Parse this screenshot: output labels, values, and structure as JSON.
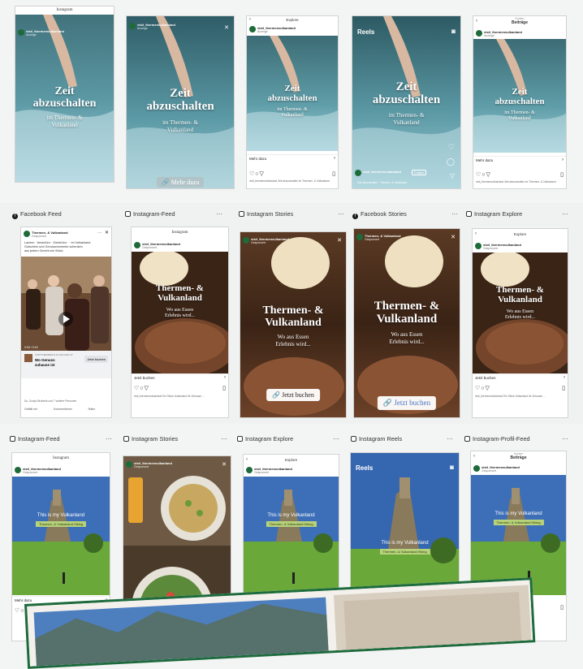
{
  "colors": {
    "accent_green": "#1e6b3a",
    "pill_green": "#b7d27a",
    "background": "#f3f4f4"
  },
  "account": {
    "name": "visit_thermenvulkanland",
    "sub": "Anzeige",
    "sub_ig": "Gesponsert"
  },
  "row1": {
    "overlay_title_a": "Zeit",
    "overlay_title_b": "abzuschalten",
    "overlay_sub_a": "im Thermen- &",
    "overlay_sub_b": "Vulkanland",
    "phone1_header": "Instagram",
    "phone3_header": "Explore",
    "phone4_header": "Reels",
    "phone5_header_small": "Konten",
    "phone5_header": "Beiträge",
    "more_label": "Mehr dazu",
    "more_button": "Mehr dazu",
    "follow_label": "Folgen",
    "caption": "visit_thermenvulkanland Zeit abzuschalten im Thermen- & Vulkanland",
    "reels_caption": "Zeit abzuschalten · Thermen- & Vulkanland"
  },
  "row2": {
    "labels": [
      "Facebook Feed",
      "Instagram-Feed",
      "Instagram Stories",
      "Facebook Stories",
      "Instagram Explore"
    ],
    "overlay_title_a": "Thermen- &",
    "overlay_title_b": "Vulkanland",
    "overlay_sub_a": "Wo aus Essen",
    "overlay_sub_b": "Erlebnis wird...",
    "book_label": "Jetzt buchen",
    "book_button": "Jetzt buchen",
    "fb_page": "Thermen- & Vulkanland",
    "fb_sub": "Gesponsert",
    "fb_text_1": "Lachen · Anstoßen · Genießen · · im Vulkanland",
    "fb_text_2": "Gutschein und Genussmomente schenken",
    "fb_text_3": "aus jedem Gericht ein Stück",
    "fb_video_time": "0:00 / 0:15",
    "fb_cta_small": "VISITTHERMENVULKANLAND.AT",
    "fb_cta_title": "Wo Genuss",
    "fb_cta_title2": "zuhause ist",
    "fb_cta_button": "Jetzt buchen",
    "fb_reactions": "Du, Sonja Struberik und 7 weitere Personen",
    "fb_actions": [
      "Gefällt mir",
      "Kommentieren",
      "Teilen"
    ],
    "explore_header": "Explore",
    "caption": "visit_thermenvulkanland Ein Stück Vulkanland für Zuhause ..."
  },
  "row3": {
    "labels": [
      "Instagram-Feed",
      "Instagram Stories",
      "Instagram Explore",
      "Instagram Reels",
      "Instagram-Profil-Feed"
    ],
    "overlay_title": "This is my Vulkanland",
    "pill": "Thermen- & Vulkanland Hiking",
    "header_instagram": "Instagram",
    "header_explore": "Explore",
    "header_reels": "Reels",
    "header_profile_small": "Konten",
    "header_profile": "Beiträge",
    "more_label": "Mehr dazu",
    "caption": "visit_thermenvulkanland Wandern ..."
  }
}
